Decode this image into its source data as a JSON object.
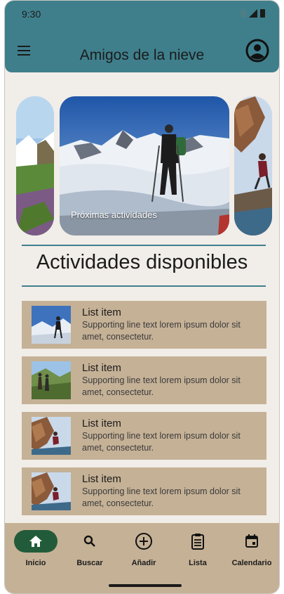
{
  "status_bar": {
    "time": "9:30"
  },
  "app_bar": {
    "title": "Amigos de la nieve"
  },
  "carousel": {
    "main_caption": "Próximas actividades"
  },
  "section": {
    "title": "Actividades disponibles"
  },
  "list": [
    {
      "headline": "List item",
      "supporting": "Supporting line text lorem ipsum dolor sit amet, consectetur.",
      "thumb": "snow-hiker"
    },
    {
      "headline": "List item",
      "supporting": "Supporting line text lorem ipsum dolor sit amet, consectetur.",
      "thumb": "mountain-hikers"
    },
    {
      "headline": "List item",
      "supporting": "Supporting line text lorem ipsum dolor sit amet, consectetur.",
      "thumb": "rock-climber"
    },
    {
      "headline": "List item",
      "supporting": "Supporting line text lorem ipsum dolor sit amet, consectetur.",
      "thumb": "rock-climber"
    }
  ],
  "bottom_nav": {
    "items": [
      {
        "label": "Inicio",
        "icon": "home-icon",
        "active": true
      },
      {
        "label": "Buscar",
        "icon": "search-icon",
        "active": false
      },
      {
        "label": "Añadir",
        "icon": "add-circle-icon",
        "active": false
      },
      {
        "label": "Lista",
        "icon": "list-icon",
        "active": false
      },
      {
        "label": "Calendario",
        "icon": "calendar-icon",
        "active": false
      }
    ]
  },
  "colors": {
    "app_bar": "#3f7f8c",
    "background": "#f1ede8",
    "list_item": "#c5b196",
    "nav_active": "#225b3a"
  }
}
